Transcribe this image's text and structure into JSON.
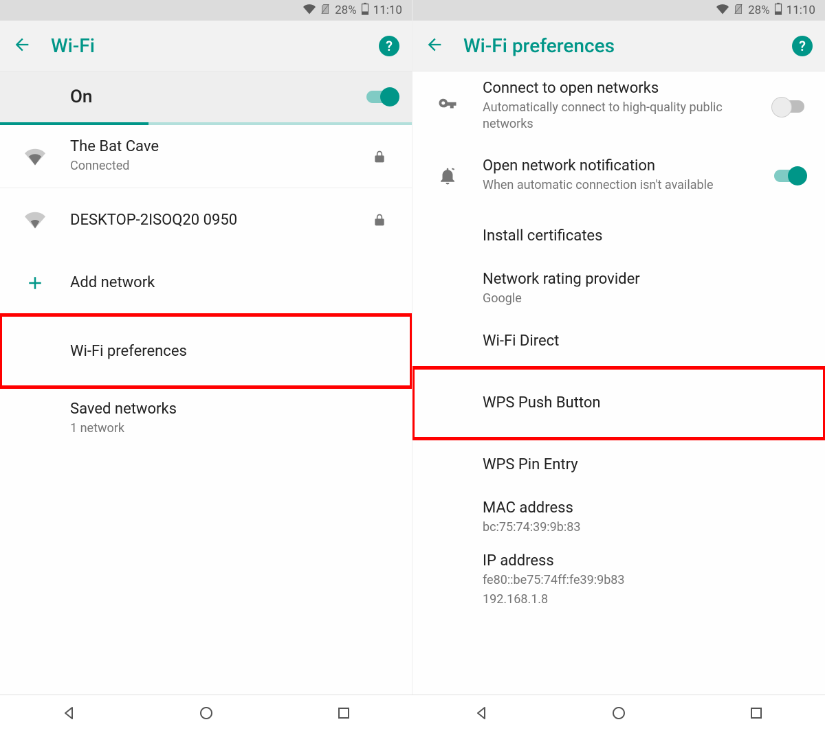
{
  "status": {
    "battery_pct": "28%",
    "time": "11:10"
  },
  "left": {
    "title": "Wi-Fi",
    "toggle_label": "On",
    "networks": [
      {
        "ssid": "The Bat Cave",
        "status": "Connected",
        "locked": true
      },
      {
        "ssid": "DESKTOP-2ISOQ20 0950",
        "status": "",
        "locked": true
      }
    ],
    "add_network": "Add network",
    "wifi_preferences": "Wi-Fi preferences",
    "saved_networks": {
      "label": "Saved networks",
      "sub": "1 network"
    }
  },
  "right": {
    "title": "Wi-Fi preferences",
    "items": {
      "connect_open": {
        "label": "Connect to open networks",
        "sub": "Automatically connect to high-quality public networks"
      },
      "open_notif": {
        "label": "Open network notification",
        "sub": "When automatic connection isn't available"
      },
      "install_certs": "Install certificates",
      "rating_provider": {
        "label": "Network rating provider",
        "sub": "Google"
      },
      "wifi_direct": "Wi-Fi Direct",
      "wps_push": "WPS Push Button",
      "wps_pin": "WPS Pin Entry",
      "mac": {
        "label": "MAC address",
        "value": "bc:75:74:39:9b:83"
      },
      "ip": {
        "label": "IP address",
        "value1": "fe80::be75:74ff:fe39:9b83",
        "value2": "192.168.1.8"
      }
    }
  }
}
